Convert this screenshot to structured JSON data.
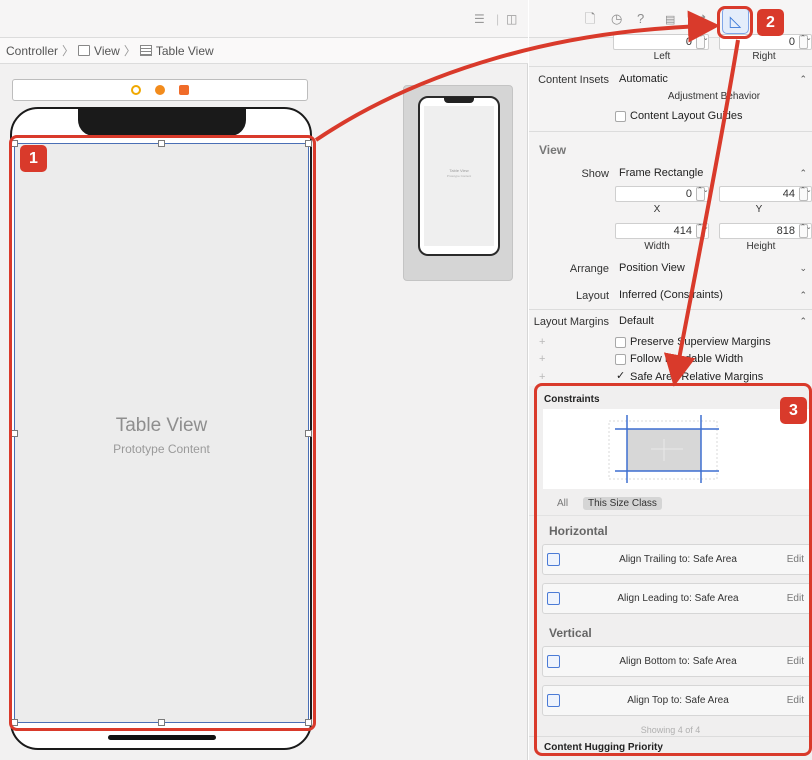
{
  "breadcrumb": {
    "items": [
      "Controller",
      "View",
      "Table View"
    ],
    "separator": "〉"
  },
  "canvas": {
    "table_view_title": "Table View",
    "table_view_subtitle": "Prototype Content",
    "mini_title": "Table View",
    "mini_subtitle": "Prototype Content"
  },
  "inspector": {
    "left_label": "Left",
    "right_label": "Right",
    "left_value": "0",
    "right_value": "0",
    "content_insets_label": "Content Insets",
    "content_insets_value": "Automatic",
    "adjustment_behavior_caption": "Adjustment Behavior",
    "content_layout_guides_label": "Content Layout Guides",
    "view_section_title": "View",
    "show_label": "Show",
    "show_value": "Frame Rectangle",
    "x_value": "0",
    "y_value": "44",
    "x_caption": "X",
    "y_caption": "Y",
    "width_value": "414",
    "height_value": "818",
    "width_caption": "Width",
    "height_caption": "Height",
    "arrange_label": "Arrange",
    "arrange_value": "Position View",
    "layout_label": "Layout",
    "layout_value": "Inferred (Constraints)",
    "layout_margins_label": "Layout Margins",
    "layout_margins_value": "Default",
    "preserve_superview_label": "Preserve Superview Margins",
    "follow_readable_label": "Follow Readable Width",
    "safe_area_relative_label": "Safe Area Relative Margins",
    "safe_area_checkmark": "✓",
    "constraints_title": "Constraints",
    "constraint_tab_all": "All",
    "constraint_tab_size_class": "This Size Class",
    "horizontal_title": "Horizontal",
    "vertical_title": "Vertical",
    "constraints": [
      {
        "text": "Align Trailing to:  Safe Area",
        "edit": "Edit"
      },
      {
        "text": "Align Leading to:  Safe Area",
        "edit": "Edit"
      },
      {
        "text": "Align Bottom to:  Safe Area",
        "edit": "Edit"
      },
      {
        "text": "Align Top to:  Safe Area",
        "edit": "Edit"
      }
    ],
    "showing_text": "Showing 4 of 4",
    "content_hugging_title": "Content Hugging Priority"
  },
  "callouts": [
    "1",
    "2",
    "3"
  ],
  "colors": {
    "callout_red": "#d93a2b",
    "selection_blue": "#3b78d8",
    "canvas_bg": "#f2f1f1"
  }
}
